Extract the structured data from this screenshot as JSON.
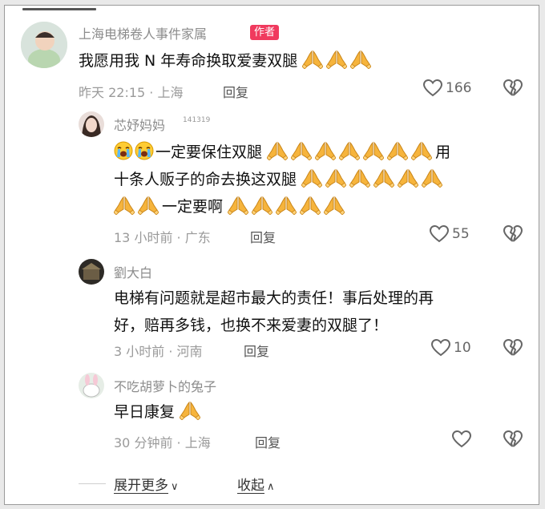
{
  "main_comment": {
    "username": "上海电梯卷人事件家属",
    "badge": "作者",
    "text": "我愿用我 N 年寿命换取爱妻双腿",
    "time_location": "昨天 22:15 · 上海",
    "reply_label": "回复",
    "likes": "166"
  },
  "replies": [
    {
      "username": "芯妤妈妈",
      "sup": "141319",
      "line1_text_a": "一定要保住双腿",
      "line1_text_b": "用",
      "line2_text": "十条人贩子的命去换这双腿",
      "line3_text": "一定要啊",
      "time_location": "13 小时前 · 广东",
      "reply_label": "回复",
      "likes": "55"
    },
    {
      "username": "劉大白",
      "line1": "电梯有问题就是超市最大的责任！事后处理的再",
      "line2": "好，赔再多钱，也换不来爱妻的双腿了！",
      "time_location": "3 小时前 · 河南",
      "reply_label": "回复",
      "likes": "10"
    },
    {
      "username": "不吃胡萝卜的兔子",
      "text": "早日康复",
      "time_location": "30 分钟前 · 上海",
      "reply_label": "回复"
    }
  ],
  "footer": {
    "expand_label": "展开更多",
    "collapse_label": "收起"
  },
  "icons": {
    "like": "heart-outline-icon",
    "dislike": "broken-heart-icon",
    "pray": "folded-hands-emoji-icon",
    "cry": "loudly-crying-face-emoji-icon"
  },
  "colors": {
    "badge": "#f03a5e",
    "meta": "#9a9a9a",
    "emoji": "#f5a623"
  }
}
